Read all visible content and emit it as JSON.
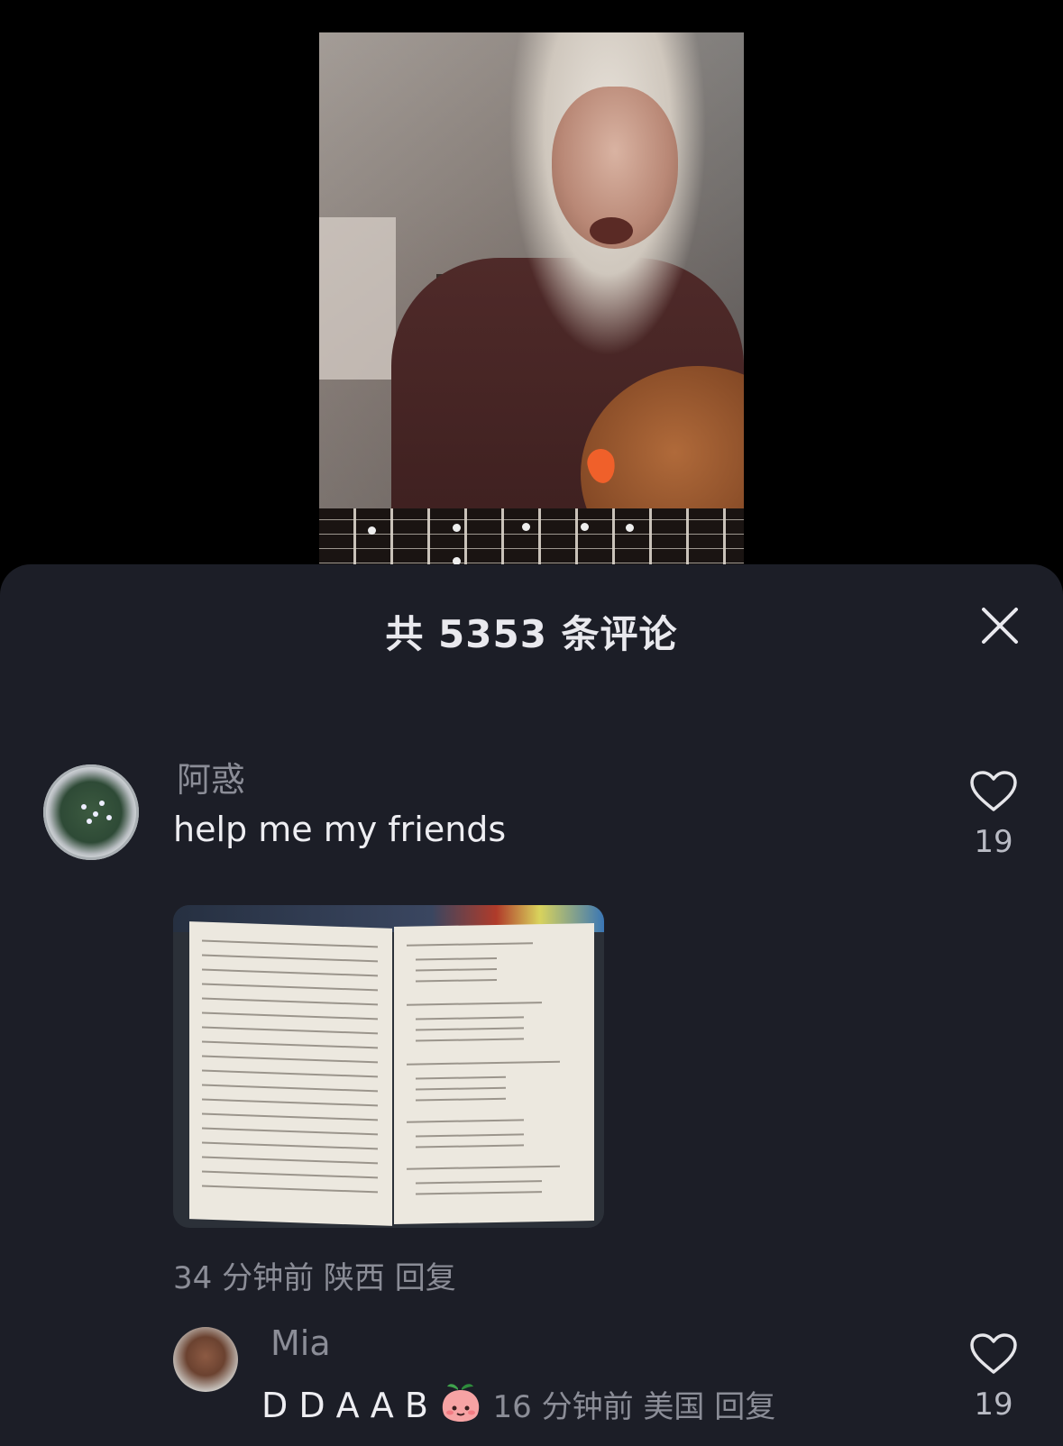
{
  "video": {
    "description_icon": "video-frame"
  },
  "sheet": {
    "title": "共 5353 条评论",
    "close_icon": "close-icon"
  },
  "comments": [
    {
      "username": "阿惑",
      "text": "help me my friends",
      "has_image": true,
      "time": "34 分钟前",
      "location": "陕西",
      "reply_label": "回复",
      "likes": "19"
    },
    {
      "username": "Mia",
      "text": "D D A A B",
      "emoji": "peach-emoji",
      "time": "16 分钟前",
      "location": "美国",
      "reply_label": "回复",
      "likes": "19"
    }
  ],
  "colors": {
    "sheet_bg": "#1c1e27",
    "text_primary": "#eeeef2",
    "text_secondary": "#8b8d97"
  }
}
